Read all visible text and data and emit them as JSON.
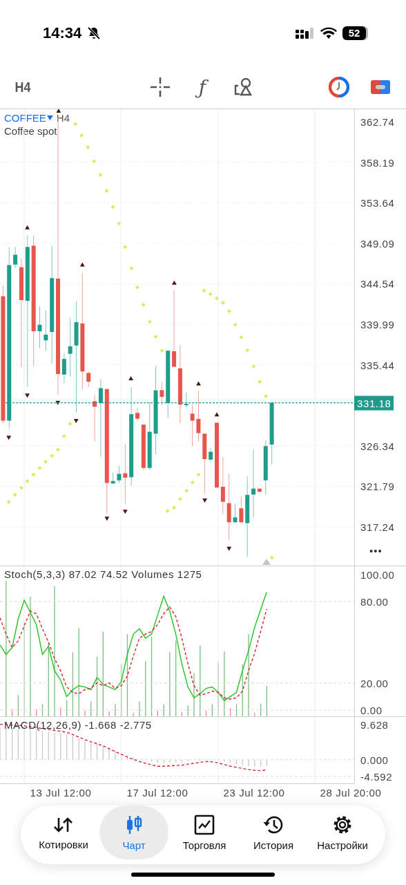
{
  "status_bar": {
    "time": "14:34",
    "battery": "52"
  },
  "toolbar": {
    "timeframe": "H4",
    "function_label": "ƒ"
  },
  "chart": {
    "symbol": "COFFEE",
    "timeframe": "H4",
    "description": "Coffee spot",
    "more_label": "•••",
    "current_price": "331.18",
    "chart_data": {
      "type": "candlestick",
      "grid": true,
      "ylim": [
        312.9,
        364.14
      ],
      "yticks": [
        {
          "value": 362.74,
          "label": "362.74"
        },
        {
          "value": 358.19,
          "label": "358.19"
        },
        {
          "value": 353.64,
          "label": "353.64"
        },
        {
          "value": 349.09,
          "label": "349.09"
        },
        {
          "value": 344.54,
          "label": "344.54"
        },
        {
          "value": 339.99,
          "label": "339.99"
        },
        {
          "value": 335.44,
          "label": "335.44"
        },
        {
          "value": 326.34,
          "label": "326.34"
        },
        {
          "value": 321.79,
          "label": "321.79"
        },
        {
          "value": 317.24,
          "label": "317.24"
        }
      ],
      "categories": [
        null,
        null,
        null,
        null,
        null,
        null,
        null,
        null,
        null,
        null,
        null,
        null,
        null,
        null,
        null,
        null,
        null,
        null,
        null,
        null,
        null,
        null,
        null,
        null,
        null,
        null,
        null,
        null,
        null,
        null,
        null,
        null,
        null,
        null,
        null,
        null,
        null,
        null,
        null,
        null,
        null,
        null,
        null,
        null,
        null,
        null,
        null,
        null,
        null,
        null,
        null,
        null,
        null,
        null,
        null,
        null,
        null,
        null
      ],
      "ohlc": [
        [
          343.14,
          344.31,
          328.88,
          329.17
        ],
        [
          329.17,
          348.67,
          328.3,
          346.64
        ],
        [
          346.69,
          348.67,
          346.34,
          347.8
        ],
        [
          346.4,
          347.36,
          335.14,
          342.71
        ],
        [
          342.62,
          349.98,
          332.95,
          348.67
        ],
        [
          348.82,
          349.98,
          335.28,
          339.21
        ],
        [
          339.21,
          341.98,
          337.32,
          339.94
        ],
        [
          338.19,
          341.54,
          337.03,
          338.83
        ],
        [
          339.13,
          348.82,
          335.57,
          345.18
        ],
        [
          345.12,
          363.2,
          332.08,
          334.41
        ],
        [
          334.35,
          336.74,
          333.39,
          336.1
        ],
        [
          336.68,
          340.67,
          334.12,
          337.52
        ],
        [
          337.61,
          342.56,
          330.04,
          340.23
        ],
        [
          340.09,
          345.76,
          332.66,
          334.7
        ],
        [
          334.53,
          334.7,
          332.95,
          333.54
        ],
        [
          331.35,
          332.08,
          326.84,
          330.74
        ],
        [
          331.15,
          333.83,
          325.09,
          332.81
        ],
        [
          332.72,
          332.72,
          318.69,
          322.18
        ],
        [
          322.12,
          323.35,
          322.04,
          322.39
        ],
        [
          322.47,
          324.07,
          322.18,
          323.2
        ],
        [
          323.26,
          326.55,
          319.85,
          322.77
        ],
        [
          322.82,
          332.95,
          321.89,
          329.9
        ],
        [
          330.04,
          330.63,
          329.17,
          329.4
        ],
        [
          328.73,
          328.73,
          323.64,
          323.87
        ],
        [
          323.87,
          331.21,
          323.64,
          327.92
        ],
        [
          327.71,
          335.28,
          325.39,
          332.58
        ],
        [
          332.6,
          333.54,
          330.92,
          331.85
        ],
        [
          331.15,
          337.03,
          329.52,
          337.03
        ],
        [
          336.97,
          343.78,
          335.22,
          335.22
        ],
        [
          335.05,
          337.67,
          328.88,
          330.97
        ],
        [
          330.97,
          332.37,
          330.63,
          331.06
        ],
        [
          329.96,
          330.92,
          326.26,
          329.17
        ],
        [
          329.37,
          332.52,
          326.84,
          327.77
        ],
        [
          327.71,
          327.71,
          321.02,
          324.86
        ],
        [
          324.8,
          326.11,
          324.51,
          325.68
        ],
        [
          328.94,
          328.94,
          321.66,
          321.66
        ],
        [
          321.75,
          325.09,
          318.69,
          320.06
        ],
        [
          319.91,
          323.2,
          315.78,
          317.76
        ],
        [
          317.76,
          319.85,
          317.76,
          318.31
        ],
        [
          319.33,
          320.67,
          317.76,
          317.76
        ],
        [
          317.67,
          322.91,
          313.89,
          320.84
        ],
        [
          320.87,
          325.97,
          318.25,
          321.54
        ],
        [
          321.54,
          321.6,
          321.02,
          321.19
        ],
        [
          322.47,
          326.99,
          320.87,
          326.32
        ],
        [
          326.49,
          331.21,
          324.22,
          331.18
        ],
        null,
        null,
        null,
        null,
        null,
        null,
        null,
        null,
        null,
        null,
        null,
        null,
        null
      ]
    }
  },
  "stochastic": {
    "legend": "Stoch(5,3,3) 87.02 74.52 Volumes 1275",
    "chart_data": {
      "type": "line",
      "grid": true,
      "ylim": [
        -4.6,
        106
      ],
      "yticks": [
        {
          "value": 100,
          "label": "100.00"
        },
        {
          "value": 80,
          "label": "80.00"
        },
        {
          "value": 20,
          "label": "20.00"
        },
        {
          "value": 0,
          "label": "0.00"
        }
      ],
      "series": [
        {
          "color": "#22c322",
          "line_style": "solid",
          "values": [
            48,
            41,
            46,
            67,
            81,
            72,
            63,
            41,
            47,
            29,
            22,
            10,
            15,
            18,
            17,
            15,
            24,
            19,
            17,
            15,
            21,
            41,
            56,
            60,
            53,
            56,
            70,
            84,
            73,
            56,
            34,
            17,
            9,
            12,
            16,
            17,
            13,
            7,
            10,
            13,
            29,
            44,
            61,
            74,
            87
          ]
        },
        {
          "color": "#d9262f",
          "line_style": "dashed",
          "values": [
            68,
            56,
            46,
            51,
            62,
            73,
            71,
            60,
            50,
            38,
            29,
            17,
            13,
            12,
            15,
            16,
            20,
            18,
            20,
            16,
            18,
            25,
            40,
            53,
            56,
            58,
            63,
            71,
            76,
            69,
            53,
            34,
            18,
            11,
            12,
            14,
            13,
            9,
            8,
            9,
            14,
            29,
            42,
            58,
            74.5
          ]
        }
      ]
    }
  },
  "macd": {
    "legend": "MACD(12,26,9) -1.668 -2.775",
    "chart_data": {
      "type": "line",
      "grid": true,
      "ylim": [
        -6.49,
        11.71
      ],
      "yticks": [
        {
          "value": 9.628,
          "label": "9.628"
        },
        {
          "value": 0,
          "label": "0.000"
        },
        {
          "value": -4.592,
          "label": "-4.592"
        }
      ],
      "series": [
        {
          "color": "#d9262f",
          "line_style": "dashed",
          "values": [
            9.7,
            9.6,
            9.5,
            9.4,
            9.3,
            9.0,
            8.8,
            8.5,
            8.3,
            8.0,
            7.8,
            7.5,
            6.9,
            6.2,
            5.5,
            4.9,
            4.4,
            3.8,
            3.0,
            2.2,
            1.5,
            0.7,
            0.1,
            -0.5,
            -1.0,
            -1.4,
            -1.8,
            -1.8,
            -1.7,
            -1.6,
            -1.5,
            -1.2,
            -1.0,
            -0.7,
            -0.5,
            -0.6,
            -0.9,
            -1.3,
            -1.8,
            -2.1,
            -2.4,
            -2.7,
            -2.9,
            -3.0,
            -2.8
          ]
        }
      ]
    }
  },
  "time_axis": [
    "13 Jul 12:00",
    "17 Jul 12:00",
    "23 Jul 12:00",
    "28 Jul 20:00"
  ],
  "tabs": [
    {
      "label": "Котировки",
      "selected": false
    },
    {
      "label": "Чарт",
      "selected": true
    },
    {
      "label": "Торговля",
      "selected": false
    },
    {
      "label": "История",
      "selected": false
    },
    {
      "label": "Настройки",
      "selected": false
    }
  ]
}
